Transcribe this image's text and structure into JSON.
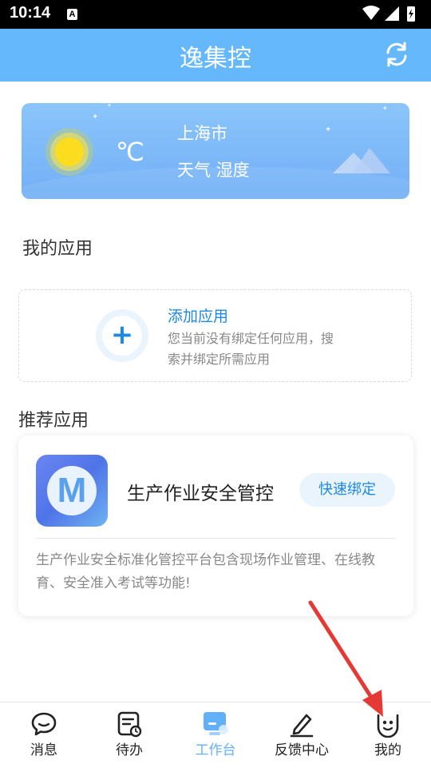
{
  "status_bar": {
    "time": "10:14",
    "notif_icon": "A"
  },
  "header": {
    "title": "逸集控",
    "refresh_icon": "refresh-icon"
  },
  "weather": {
    "temp": "℃",
    "city": "上海市",
    "desc": "天气 湿度"
  },
  "my_apps": {
    "title": "我的应用",
    "add_title": "添加应用",
    "add_desc": "您当前没有绑定任何应用，搜索并绑定所需应用",
    "add_symbol": "+"
  },
  "recommend": {
    "title": "推荐应用",
    "app_name": "生产作业安全管控",
    "logo_letter": "M",
    "bind_label": "快速绑定",
    "desc": "生产作业安全标准化管控平台包含现场作业管理、在线教育、安全准入考试等功能!"
  },
  "tabs": [
    {
      "label": "消息",
      "icon": "message-icon"
    },
    {
      "label": "待办",
      "icon": "todo-icon"
    },
    {
      "label": "工作台",
      "icon": "workbench-icon"
    },
    {
      "label": "反馈中心",
      "icon": "feedback-icon"
    },
    {
      "label": "我的",
      "icon": "profile-icon"
    }
  ],
  "colors": {
    "header": "#66b8fc",
    "accent": "#1e88e5",
    "tab_active": "#62b0f9",
    "annotation_arrow": "#e53935"
  }
}
